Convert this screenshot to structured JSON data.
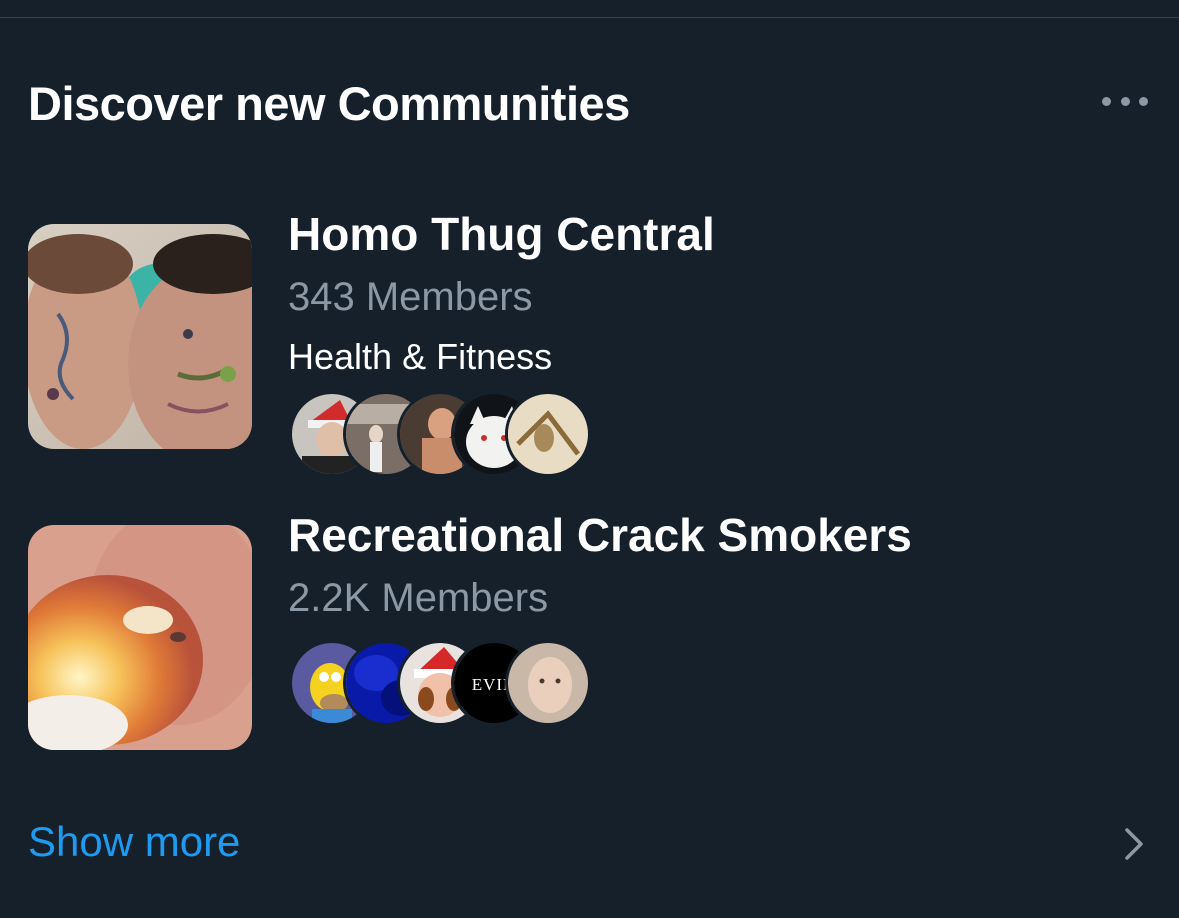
{
  "section": {
    "title": "Discover new Communities",
    "more_icon": "ellipsis-icon"
  },
  "communities": [
    {
      "name": "Homo Thug Central",
      "members": "343 Members",
      "topic": "Health & Fitness",
      "avatars": [
        "member-avatar",
        "member-avatar",
        "member-avatar",
        "member-avatar",
        "member-avatar"
      ]
    },
    {
      "name": "Recreational Crack Smokers",
      "members": "2.2K Members",
      "avatars": [
        "member-avatar",
        "member-avatar",
        "member-avatar",
        "member-avatar",
        "member-avatar"
      ],
      "avatar_text": "EVIN"
    }
  ],
  "footer": {
    "show_more_label": "Show more",
    "chevron_icon": "chevron-right-icon"
  },
  "colors": {
    "background": "#15202b",
    "divider": "#38444d",
    "primary_text": "#ffffff",
    "secondary_text": "#8b98a5",
    "accent": "#1d9bf0"
  }
}
